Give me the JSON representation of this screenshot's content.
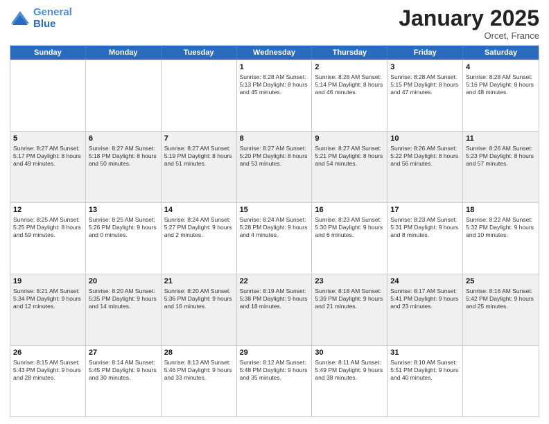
{
  "header": {
    "logo_line1": "General",
    "logo_line2": "Blue",
    "month": "January 2025",
    "location": "Orcet, France"
  },
  "days": [
    "Sunday",
    "Monday",
    "Tuesday",
    "Wednesday",
    "Thursday",
    "Friday",
    "Saturday"
  ],
  "rows": [
    [
      {
        "date": "",
        "info": ""
      },
      {
        "date": "",
        "info": ""
      },
      {
        "date": "",
        "info": ""
      },
      {
        "date": "1",
        "info": "Sunrise: 8:28 AM\nSunset: 5:13 PM\nDaylight: 8 hours and 45 minutes."
      },
      {
        "date": "2",
        "info": "Sunrise: 8:28 AM\nSunset: 5:14 PM\nDaylight: 8 hours and 46 minutes."
      },
      {
        "date": "3",
        "info": "Sunrise: 8:28 AM\nSunset: 5:15 PM\nDaylight: 8 hours and 47 minutes."
      },
      {
        "date": "4",
        "info": "Sunrise: 8:28 AM\nSunset: 5:16 PM\nDaylight: 8 hours and 48 minutes."
      }
    ],
    [
      {
        "date": "5",
        "info": "Sunrise: 8:27 AM\nSunset: 5:17 PM\nDaylight: 8 hours and 49 minutes."
      },
      {
        "date": "6",
        "info": "Sunrise: 8:27 AM\nSunset: 5:18 PM\nDaylight: 8 hours and 50 minutes."
      },
      {
        "date": "7",
        "info": "Sunrise: 8:27 AM\nSunset: 5:19 PM\nDaylight: 8 hours and 51 minutes."
      },
      {
        "date": "8",
        "info": "Sunrise: 8:27 AM\nSunset: 5:20 PM\nDaylight: 8 hours and 53 minutes."
      },
      {
        "date": "9",
        "info": "Sunrise: 8:27 AM\nSunset: 5:21 PM\nDaylight: 8 hours and 54 minutes."
      },
      {
        "date": "10",
        "info": "Sunrise: 8:26 AM\nSunset: 5:22 PM\nDaylight: 8 hours and 56 minutes."
      },
      {
        "date": "11",
        "info": "Sunrise: 8:26 AM\nSunset: 5:23 PM\nDaylight: 8 hours and 57 minutes."
      }
    ],
    [
      {
        "date": "12",
        "info": "Sunrise: 8:25 AM\nSunset: 5:25 PM\nDaylight: 8 hours and 59 minutes."
      },
      {
        "date": "13",
        "info": "Sunrise: 8:25 AM\nSunset: 5:26 PM\nDaylight: 9 hours and 0 minutes."
      },
      {
        "date": "14",
        "info": "Sunrise: 8:24 AM\nSunset: 5:27 PM\nDaylight: 9 hours and 2 minutes."
      },
      {
        "date": "15",
        "info": "Sunrise: 8:24 AM\nSunset: 5:28 PM\nDaylight: 9 hours and 4 minutes."
      },
      {
        "date": "16",
        "info": "Sunrise: 8:23 AM\nSunset: 5:30 PM\nDaylight: 9 hours and 6 minutes."
      },
      {
        "date": "17",
        "info": "Sunrise: 8:23 AM\nSunset: 5:31 PM\nDaylight: 9 hours and 8 minutes."
      },
      {
        "date": "18",
        "info": "Sunrise: 8:22 AM\nSunset: 5:32 PM\nDaylight: 9 hours and 10 minutes."
      }
    ],
    [
      {
        "date": "19",
        "info": "Sunrise: 8:21 AM\nSunset: 5:34 PM\nDaylight: 9 hours and 12 minutes."
      },
      {
        "date": "20",
        "info": "Sunrise: 8:20 AM\nSunset: 5:35 PM\nDaylight: 9 hours and 14 minutes."
      },
      {
        "date": "21",
        "info": "Sunrise: 8:20 AM\nSunset: 5:36 PM\nDaylight: 9 hours and 16 minutes."
      },
      {
        "date": "22",
        "info": "Sunrise: 8:19 AM\nSunset: 5:38 PM\nDaylight: 9 hours and 18 minutes."
      },
      {
        "date": "23",
        "info": "Sunrise: 8:18 AM\nSunset: 5:39 PM\nDaylight: 9 hours and 21 minutes."
      },
      {
        "date": "24",
        "info": "Sunrise: 8:17 AM\nSunset: 5:41 PM\nDaylight: 9 hours and 23 minutes."
      },
      {
        "date": "25",
        "info": "Sunrise: 8:16 AM\nSunset: 5:42 PM\nDaylight: 9 hours and 25 minutes."
      }
    ],
    [
      {
        "date": "26",
        "info": "Sunrise: 8:15 AM\nSunset: 5:43 PM\nDaylight: 9 hours and 28 minutes."
      },
      {
        "date": "27",
        "info": "Sunrise: 8:14 AM\nSunset: 5:45 PM\nDaylight: 9 hours and 30 minutes."
      },
      {
        "date": "28",
        "info": "Sunrise: 8:13 AM\nSunset: 5:46 PM\nDaylight: 9 hours and 33 minutes."
      },
      {
        "date": "29",
        "info": "Sunrise: 8:12 AM\nSunset: 5:48 PM\nDaylight: 9 hours and 35 minutes."
      },
      {
        "date": "30",
        "info": "Sunrise: 8:11 AM\nSunset: 5:49 PM\nDaylight: 9 hours and 38 minutes."
      },
      {
        "date": "31",
        "info": "Sunrise: 8:10 AM\nSunset: 5:51 PM\nDaylight: 9 hours and 40 minutes."
      },
      {
        "date": "",
        "info": ""
      }
    ]
  ]
}
